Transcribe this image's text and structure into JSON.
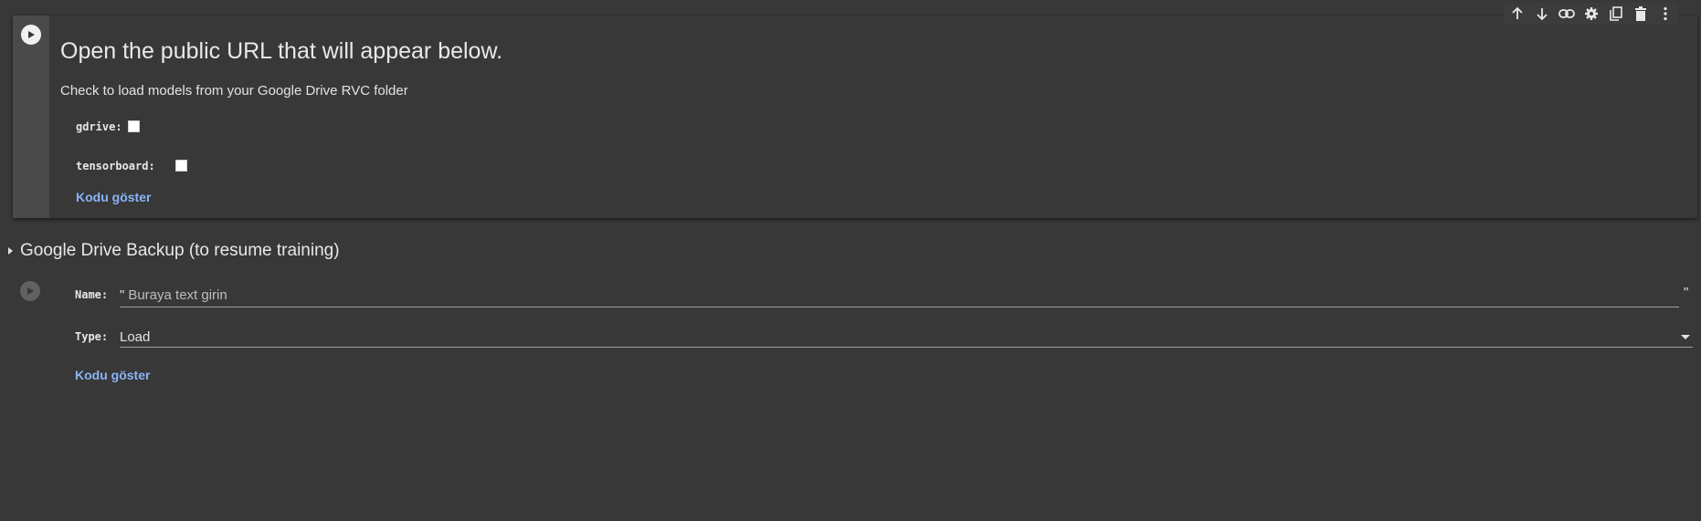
{
  "toolbar": {
    "icons": [
      "arrow-up-icon",
      "arrow-down-icon",
      "link-icon",
      "gear-icon",
      "copy-icon",
      "trash-icon",
      "more-vert-icon"
    ]
  },
  "cell1": {
    "title": "Open the public URL that will appear below.",
    "description": "Check to load models from your Google Drive RVC folder",
    "fields": [
      {
        "label": "gdrive:",
        "checked": false
      },
      {
        "label": "tensorboard:",
        "checked": false
      }
    ],
    "show_code": "Kodu göster"
  },
  "section": {
    "title": "Google Drive Backup (to resume training)"
  },
  "cell2": {
    "name_label": "Name:",
    "open_quote": "\"",
    "close_quote": "\"",
    "name_placeholder": "Buraya text girin",
    "name_value": "",
    "type_label": "Type:",
    "type_value": "Load",
    "show_code": "Kodu göster"
  },
  "colors": {
    "background": "#383838",
    "gutter": "#4a4a4a",
    "link": "#8ab4f8"
  }
}
